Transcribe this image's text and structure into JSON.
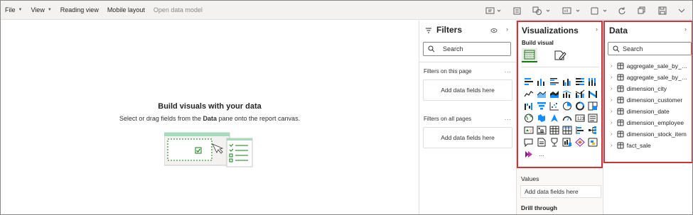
{
  "menubar": {
    "file": "File",
    "view": "View",
    "reading_view": "Reading view",
    "mobile_layout": "Mobile layout",
    "open_data_model": "Open data model"
  },
  "canvas": {
    "title": "Build visuals with your data",
    "subtitle_pre": "Select or drag fields from the ",
    "subtitle_bold": "Data",
    "subtitle_post": " pane onto the report canvas."
  },
  "filters": {
    "title": "Filters",
    "search_placeholder": "Search",
    "on_this_page": "Filters on this page",
    "on_all_pages": "Filters on all pages",
    "add_fields_1": "Add data fields here",
    "add_fields_2": "Add data fields here",
    "more": "..."
  },
  "visualizations": {
    "title": "Visualizations",
    "build_visual": "Build visual",
    "values_label": "Values",
    "values_placeholder": "Add data fields here",
    "drill_through": "Drill through",
    "more": "...",
    "icons": [
      "stacked-bar-chart-icon",
      "stacked-column-chart-icon",
      "clustered-bar-chart-icon",
      "clustered-column-chart-icon",
      "100-stacked-bar-chart-icon",
      "100-stacked-column-chart-icon",
      "line-chart-icon",
      "area-chart-icon",
      "stacked-area-chart-icon",
      "line-stacked-column-icon",
      "line-clustered-column-icon",
      "ribbon-chart-icon",
      "waterfall-chart-icon",
      "funnel-chart-icon",
      "scatter-chart-icon",
      "pie-chart-icon",
      "donut-chart-icon",
      "treemap-icon",
      "map-icon",
      "filled-map-icon",
      "azure-map-icon",
      "gauge-icon",
      "card-icon",
      "multi-row-card-icon",
      "kpi-icon",
      "slicer-icon",
      "table-icon",
      "matrix-icon",
      "key-influencers-icon",
      "decomposition-tree-icon",
      "qa-icon",
      "paginated-report-icon",
      "goals-icon",
      "narrative-icon",
      "more-visuals-icon",
      "python-visual-icon",
      "power-apps-icon",
      "more-options-icon"
    ]
  },
  "data": {
    "title": "Data",
    "search_placeholder": "Search",
    "tables": [
      "aggregate_sale_by_dat...",
      "aggregate_sale_by_dat...",
      "dimension_city",
      "dimension_customer",
      "dimension_date",
      "dimension_employee",
      "dimension_stock_item",
      "fact_sale"
    ]
  },
  "colors": {
    "highlight": "#d13438",
    "accent": "#118dff",
    "green": "#107c10"
  }
}
